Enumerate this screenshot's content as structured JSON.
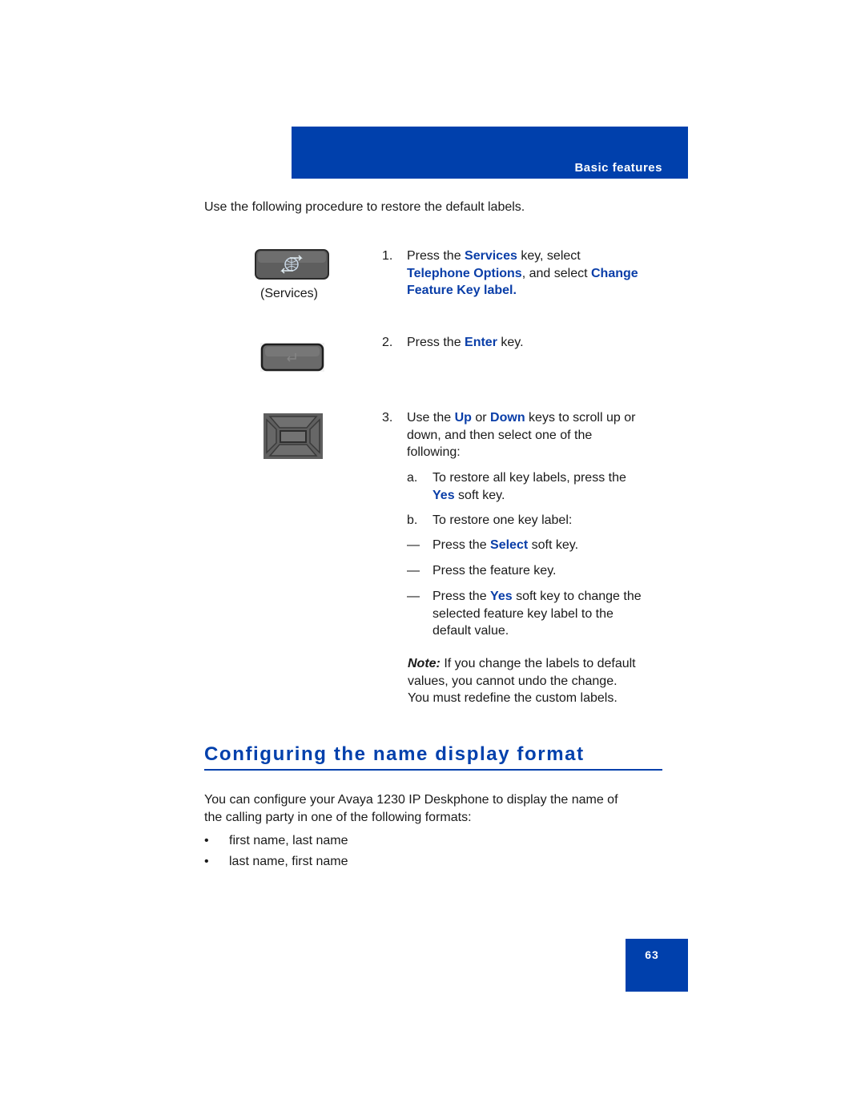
{
  "header": {
    "section_label": "Basic features"
  },
  "intro": "Use the following procedure to restore the default labels.",
  "key_images": {
    "services": {
      "icon": "services-key-icon",
      "caption": "(Services)"
    },
    "enter": {
      "icon": "enter-key-icon"
    },
    "navigation": {
      "icon": "navigation-cluster-icon"
    }
  },
  "steps": {
    "s1": {
      "num": "1.",
      "p1": "Press the ",
      "b1": "Services",
      "p2": " key, select",
      "b2": "Telephone Options",
      "p3": ", and select ",
      "b3": "Change",
      "b4": "Feature Key label."
    },
    "s2": {
      "num": "2.",
      "p1": "Press the ",
      "b1": "Enter",
      "p2": " key."
    },
    "s3": {
      "num": "3.",
      "p1": "Use the ",
      "b1": "Up",
      "p2": " or ",
      "b2": "Down",
      "p3": " keys to scroll up or",
      "line2": "down, and then select one of the",
      "line3": "following:"
    },
    "a": {
      "label": "a.",
      "p1": "To restore all key labels, press the",
      "b1": "Yes",
      "p2": " soft key."
    },
    "b": {
      "label": "b.",
      "p1": "To restore one key label:"
    },
    "d1": {
      "dash": "—",
      "p1": "Press the ",
      "b1": "Select",
      "p2": " soft key."
    },
    "d2": {
      "dash": "—",
      "p1": "Press the feature key."
    },
    "d3": {
      "dash": "—",
      "p1": "Press the ",
      "b1": "Yes",
      "p2": " soft key to change the",
      "line2": "selected feature key label to the",
      "line3": "default value."
    }
  },
  "note": {
    "label": "Note:",
    "line1": " If you change the labels to default",
    "line2": "values, you cannot undo the change.",
    "line3": "You must redefine the custom labels."
  },
  "section": {
    "heading": "Configuring the name display format",
    "paragraph_line1": "You can configure your Avaya 1230 IP Deskphone to display the name of",
    "paragraph_line2": "the calling party in one of the following formats:",
    "bullets": [
      "first name, last name",
      "last name, first name"
    ],
    "bullet_char": "•"
  },
  "footer": {
    "page_number": "63"
  },
  "colors": {
    "brand_blue": "#0040ac",
    "link_blue": "#0a3ea8"
  }
}
